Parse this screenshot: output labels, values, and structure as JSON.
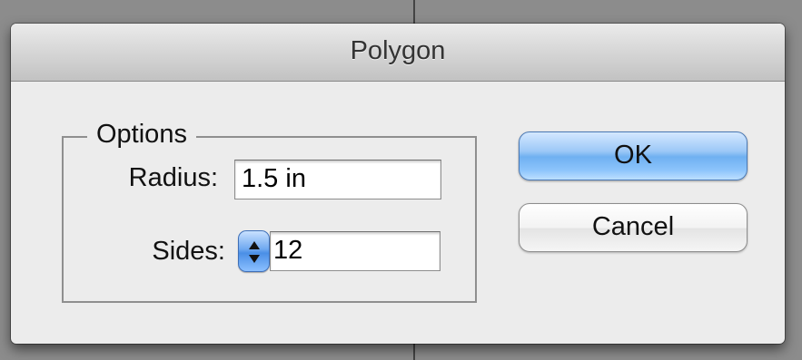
{
  "dialog": {
    "title": "Polygon"
  },
  "options": {
    "legend": "Options",
    "radius": {
      "label": "Radius:",
      "value": "1.5 in"
    },
    "sides": {
      "label": "Sides:",
      "value": "12"
    }
  },
  "buttons": {
    "ok_label": "OK",
    "cancel_label": "Cancel"
  },
  "colors": {
    "default_button_accent": "#6fb0f1",
    "stepper_accent": "#4a8fe6"
  },
  "icons": {
    "stepper": "up-down-arrows-icon"
  }
}
